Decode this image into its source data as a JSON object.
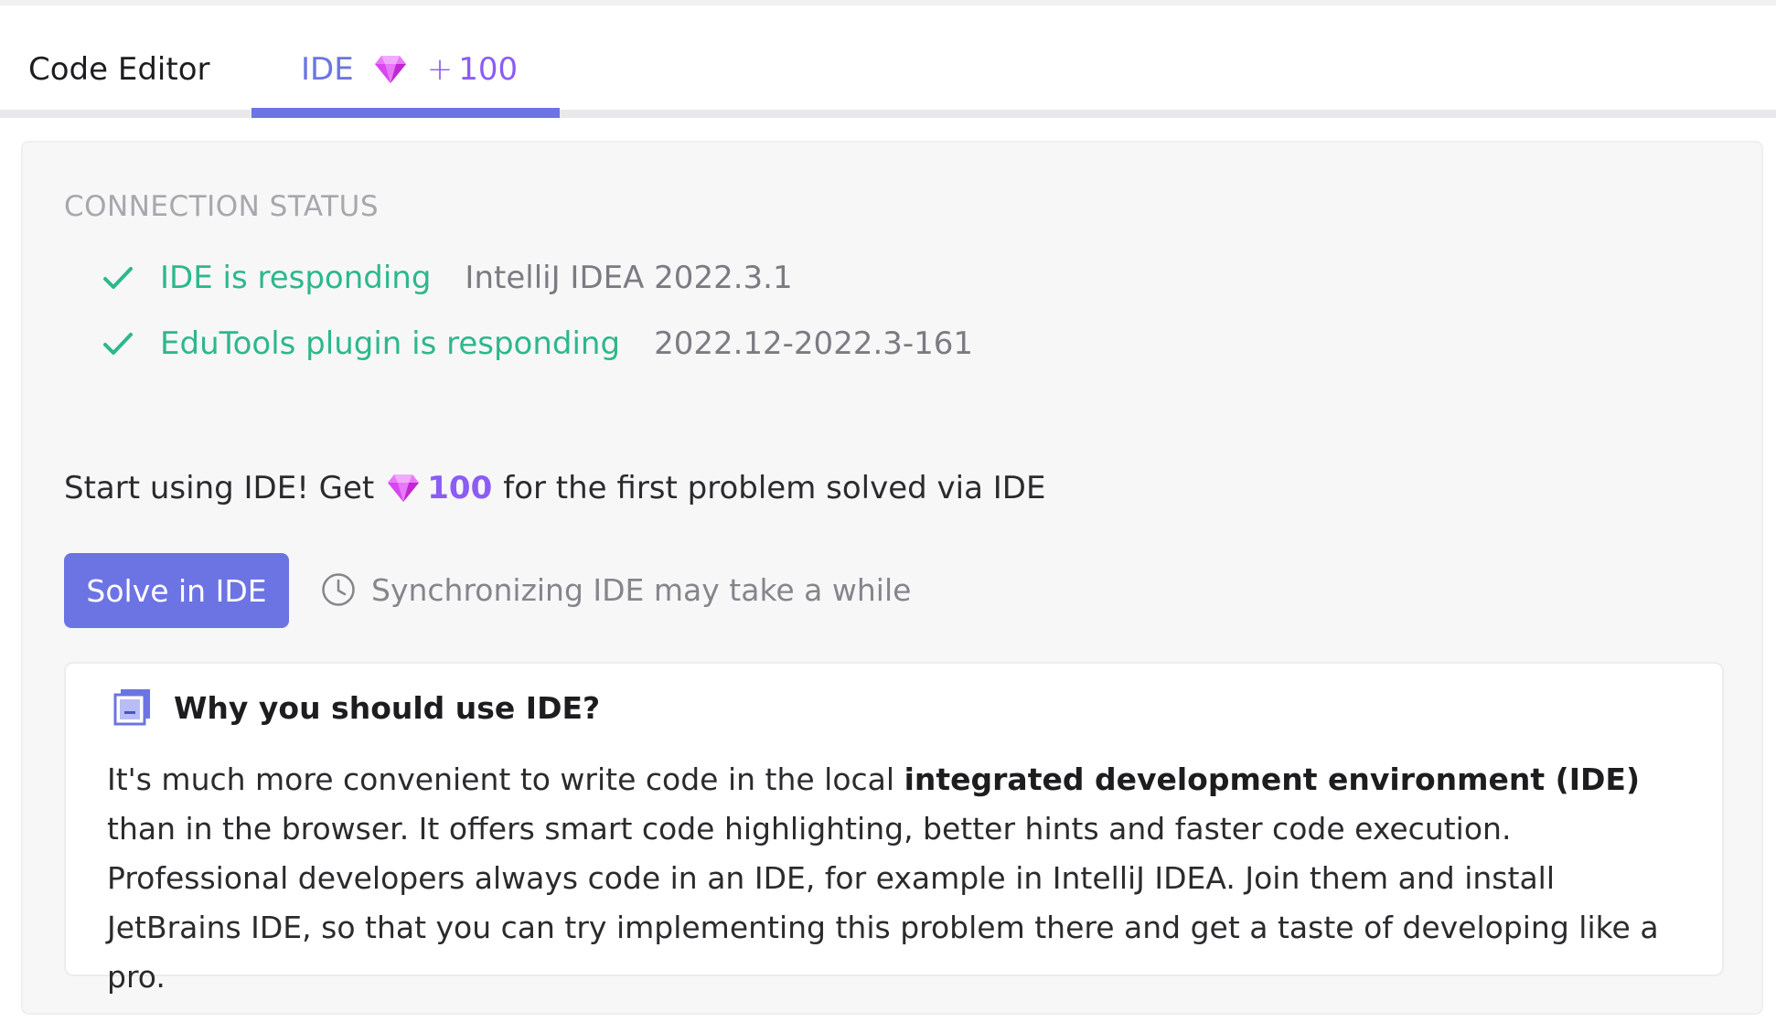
{
  "tabs": {
    "code_editor": "Code Editor",
    "ide": "IDE",
    "ide_bonus_plus": "+",
    "ide_bonus_value": "100"
  },
  "connection": {
    "title": "CONNECTION STATUS",
    "items": [
      {
        "label": "IDE is responding",
        "version": "IntelliJ IDEA 2022.3.1"
      },
      {
        "label": "EduTools plugin is responding",
        "version": "2022.12-2022.3-161"
      }
    ]
  },
  "promo": {
    "prefix": "Start using IDE! Get",
    "amount": "100",
    "suffix": "for the first problem solved via IDE"
  },
  "actions": {
    "solve_label": "Solve in IDE",
    "sync_note": "Synchronizing IDE may take a while"
  },
  "why": {
    "title": "Why you should use IDE?",
    "text_before": "It's much more convenient to write code in the local ",
    "text_bold": "integrated development environment (IDE)",
    "text_after": " than in the browser. It offers smart code highlighting, better hints and faster code execution. Professional developers always code in an IDE, for example in IntelliJ IDEA. Join them and install JetBrains IDE, so that you can try implementing this problem there and get a taste of developing like a pro."
  },
  "icons": {
    "gem": "gem-icon",
    "check": "check-icon",
    "clock": "clock-icon",
    "ide": "ide-window-icon"
  },
  "colors": {
    "accent": "#6c74e4",
    "gem": "#d946ef",
    "bonus": "#8b5cf6",
    "success": "#2db88a"
  }
}
